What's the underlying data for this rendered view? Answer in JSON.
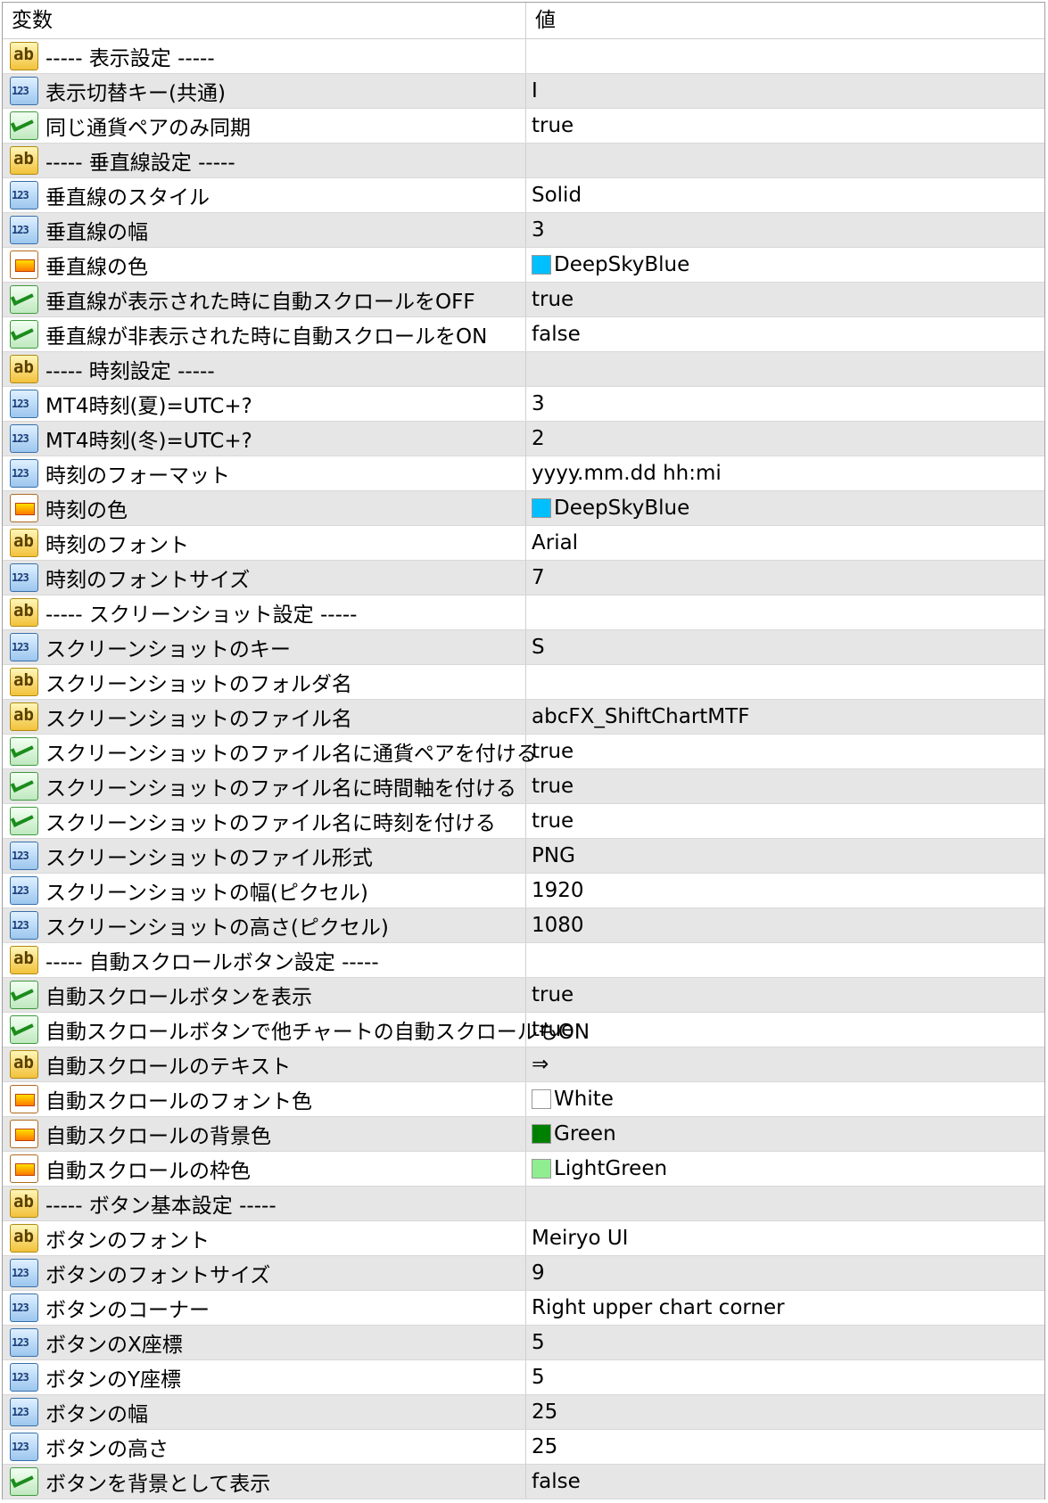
{
  "header": {
    "col_variable": "変数",
    "col_value": "値"
  },
  "rows": [
    {
      "type": "ab",
      "name": "----- 表示設定 -----",
      "value": ""
    },
    {
      "type": "num",
      "name": "表示切替キー(共通)",
      "value": "I"
    },
    {
      "type": "bool",
      "name": "同じ通貨ペアのみ同期",
      "value": "true"
    },
    {
      "type": "ab",
      "name": "----- 垂直線設定 -----",
      "value": ""
    },
    {
      "type": "num",
      "name": "垂直線のスタイル",
      "value": "Solid"
    },
    {
      "type": "num",
      "name": "垂直線の幅",
      "value": "3"
    },
    {
      "type": "color",
      "name": "垂直線の色",
      "value": "DeepSkyBlue",
      "swatch": "#00bfff"
    },
    {
      "type": "bool",
      "name": "垂直線が表示された時に自動スクロールをOFF",
      "value": "true"
    },
    {
      "type": "bool",
      "name": "垂直線が非表示された時に自動スクロールをON",
      "value": "false"
    },
    {
      "type": "ab",
      "name": "----- 時刻設定 -----",
      "value": ""
    },
    {
      "type": "num",
      "name": "MT4時刻(夏)=UTC+?",
      "value": "3"
    },
    {
      "type": "num",
      "name": "MT4時刻(冬)=UTC+?",
      "value": "2"
    },
    {
      "type": "num",
      "name": "時刻のフォーマット",
      "value": "yyyy.mm.dd hh:mi"
    },
    {
      "type": "color",
      "name": "時刻の色",
      "value": "DeepSkyBlue",
      "swatch": "#00bfff"
    },
    {
      "type": "ab",
      "name": "時刻のフォント",
      "value": "Arial"
    },
    {
      "type": "num",
      "name": "時刻のフォントサイズ",
      "value": "7"
    },
    {
      "type": "ab",
      "name": "----- スクリーンショット設定 -----",
      "value": ""
    },
    {
      "type": "num",
      "name": "スクリーンショットのキー",
      "value": "S"
    },
    {
      "type": "ab",
      "name": "スクリーンショットのフォルダ名",
      "value": ""
    },
    {
      "type": "ab",
      "name": "スクリーンショットのファイル名",
      "value": "abcFX_ShiftChartMTF"
    },
    {
      "type": "bool",
      "name": "スクリーンショットのファイル名に通貨ペアを付ける",
      "value": "true"
    },
    {
      "type": "bool",
      "name": "スクリーンショットのファイル名に時間軸を付ける",
      "value": "true"
    },
    {
      "type": "bool",
      "name": "スクリーンショットのファイル名に時刻を付ける",
      "value": "true"
    },
    {
      "type": "num",
      "name": "スクリーンショットのファイル形式",
      "value": "PNG"
    },
    {
      "type": "num",
      "name": "スクリーンショットの幅(ピクセル)",
      "value": "1920"
    },
    {
      "type": "num",
      "name": "スクリーンショットの高さ(ピクセル)",
      "value": "1080"
    },
    {
      "type": "ab",
      "name": "----- 自動スクロールボタン設定 -----",
      "value": ""
    },
    {
      "type": "bool",
      "name": "自動スクロールボタンを表示",
      "value": "true"
    },
    {
      "type": "bool",
      "name": "自動スクロールボタンで他チャートの自動スクロールもON",
      "value": "true"
    },
    {
      "type": "ab",
      "name": "自動スクロールのテキスト",
      "value": "⇒"
    },
    {
      "type": "color",
      "name": "自動スクロールのフォント色",
      "value": "White",
      "swatch": "#ffffff"
    },
    {
      "type": "color",
      "name": "自動スクロールの背景色",
      "value": "Green",
      "swatch": "#008000"
    },
    {
      "type": "color",
      "name": "自動スクロールの枠色",
      "value": "LightGreen",
      "swatch": "#90ee90"
    },
    {
      "type": "ab",
      "name": "----- ボタン基本設定 -----",
      "value": ""
    },
    {
      "type": "ab",
      "name": "ボタンのフォント",
      "value": "Meiryo UI"
    },
    {
      "type": "num",
      "name": "ボタンのフォントサイズ",
      "value": "9"
    },
    {
      "type": "num",
      "name": "ボタンのコーナー",
      "value": "Right upper chart corner"
    },
    {
      "type": "num",
      "name": "ボタンのX座標",
      "value": "5"
    },
    {
      "type": "num",
      "name": "ボタンのY座標",
      "value": "5"
    },
    {
      "type": "num",
      "name": "ボタンの幅",
      "value": "25"
    },
    {
      "type": "num",
      "name": "ボタンの高さ",
      "value": "25"
    },
    {
      "type": "bool",
      "name": "ボタンを背景として表示",
      "value": "false"
    }
  ]
}
